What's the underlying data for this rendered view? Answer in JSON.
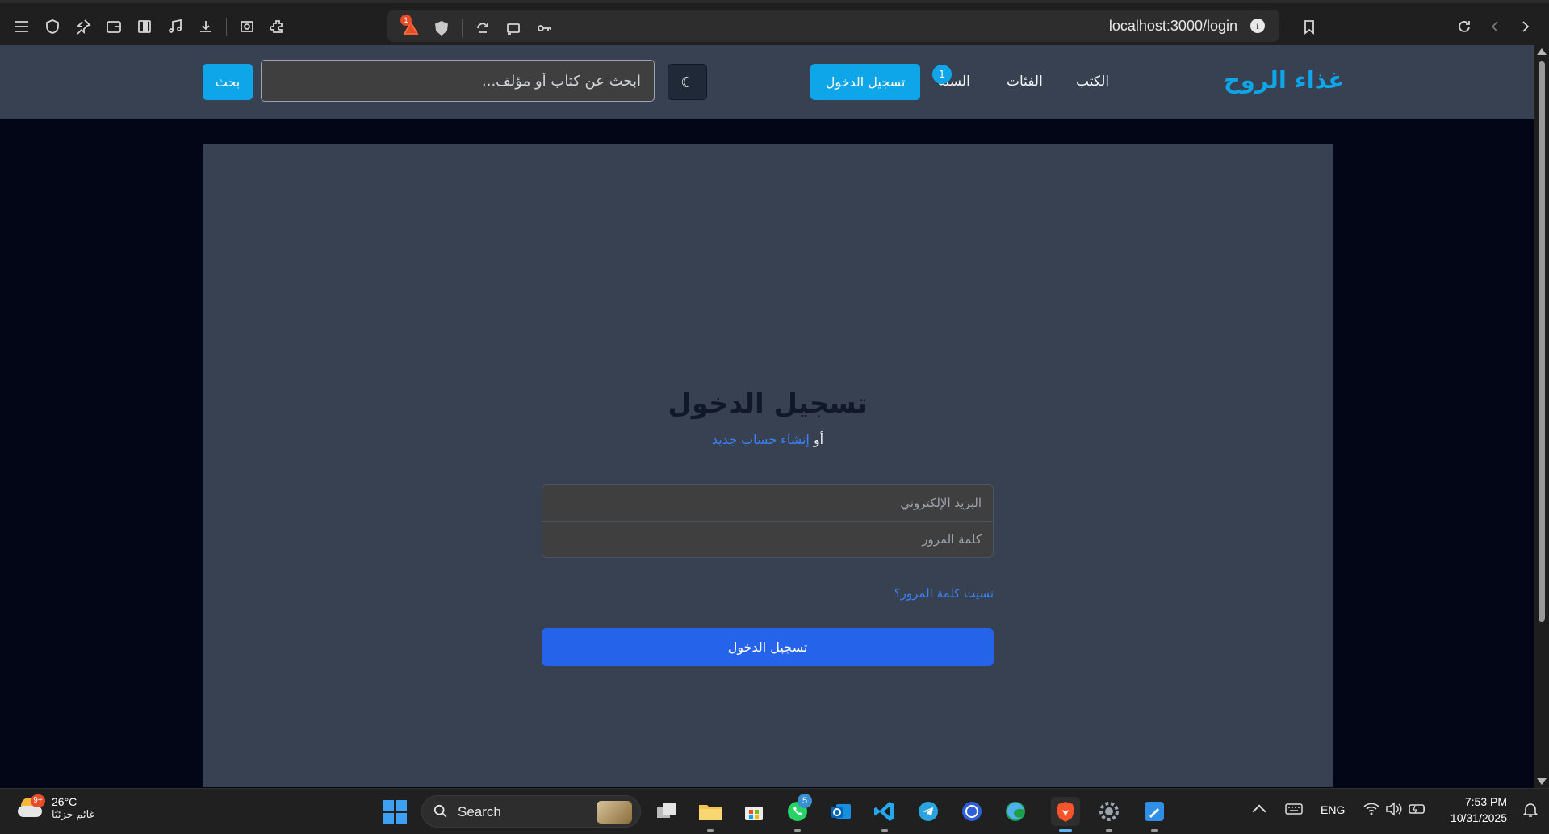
{
  "browser": {
    "url": "localhost:3000/login",
    "info_icon": "i",
    "brave_rewards_badge": "1"
  },
  "site": {
    "brand": "غذاء الروح",
    "nav": {
      "books": "الكتب",
      "categories": "الفئات",
      "cart": "السلة",
      "cart_count": "1"
    },
    "login_button": "تسجيل الدخول",
    "theme_toggle": "☾",
    "search": {
      "placeholder": "ابحث عن كتاب أو مؤلف...",
      "value": "",
      "button": "بحث"
    }
  },
  "login": {
    "title": "تسجيل الدخول",
    "subtitle_prefix": "أو",
    "register_link": "إنشاء حساب جديد",
    "email_placeholder": "البريد الإلكتروني",
    "password_placeholder": "كلمة المرور",
    "forgot_password": "نسيت كلمة المرور؟",
    "submit": "تسجيل الدخول"
  },
  "taskbar": {
    "weather": {
      "temp": "26°C",
      "desc": "غائم جزئيًا",
      "badge": "9+"
    },
    "search_label": "Search",
    "whatsapp_badge": "5",
    "language": "ENG",
    "time": "7:53 PM",
    "date": "10/31/2025"
  },
  "colors": {
    "accent": "#0ea5e9",
    "primary_button": "#2563eb",
    "link": "#3b82f6",
    "header_bg": "#374151",
    "page_bg": "#020617"
  },
  "icons": [
    "menu-icon",
    "shield-icon",
    "pin-icon",
    "wallet-icon",
    "sidebar-icon",
    "music-icon",
    "download-icon",
    "screenshot-icon",
    "extensions-icon",
    "brave-rewards-icon",
    "brave-shield-icon",
    "share-icon",
    "cast-icon",
    "key-icon",
    "bookmark-icon",
    "reload-icon",
    "back-icon",
    "forward-icon"
  ]
}
